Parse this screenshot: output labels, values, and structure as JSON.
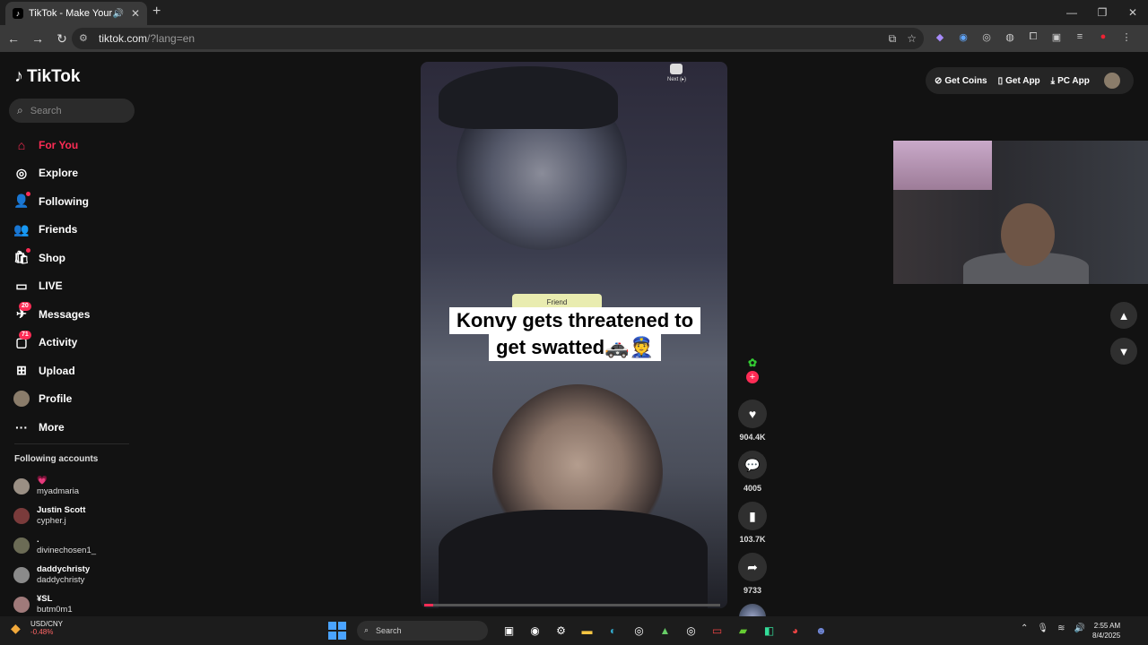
{
  "browser": {
    "tab_title": "TikTok - Make Your Day",
    "url_host": "tiktok.com",
    "url_path": "/?lang=en"
  },
  "tiktok": {
    "logo_text": "TikTok",
    "search_placeholder": "Search",
    "nav": [
      {
        "label": "For You",
        "icon": "home-icon",
        "active": true
      },
      {
        "label": "Explore",
        "icon": "compass-icon"
      },
      {
        "label": "Following",
        "icon": "following-icon"
      },
      {
        "label": "Friends",
        "icon": "friends-icon"
      },
      {
        "label": "Shop",
        "icon": "shop-icon"
      },
      {
        "label": "LIVE",
        "icon": "live-icon"
      },
      {
        "label": "Messages",
        "icon": "messages-icon",
        "badge": "20"
      },
      {
        "label": "Activity",
        "icon": "activity-icon",
        "badge": "71"
      },
      {
        "label": "Upload",
        "icon": "upload-icon"
      },
      {
        "label": "Profile",
        "icon": "avatar"
      },
      {
        "label": "More",
        "icon": "more-icon"
      }
    ],
    "following_title": "Following accounts",
    "following": [
      {
        "display": "💗",
        "username": "myadmaria"
      },
      {
        "display": "Justin Scott",
        "username": "cypher.j"
      },
      {
        "display": ".",
        "username": "divinechosen1_"
      },
      {
        "display": "daddychristy",
        "username": "daddychristy"
      },
      {
        "display": "¥SL",
        "username": "butm0m1"
      }
    ],
    "topbar": {
      "coins": "Get Coins",
      "app": "Get App",
      "pc_app": "PC App"
    },
    "video": {
      "caption_line1": "Konvy gets threatened to",
      "caption_line2": "get swatted🚓👮",
      "friend_pill": "Friend",
      "next_tag": "Next (▸)",
      "progress_fraction": 0.03
    },
    "actions": {
      "likes": "904.4K",
      "comments": "4005",
      "saves": "103.7K",
      "shares": "9733"
    }
  },
  "taskbar": {
    "ticker_symbol": "USD/CNY",
    "ticker_change": "-0.48%",
    "search_label": "Search",
    "time": "2:55 AM",
    "date": "8/4/2025"
  }
}
